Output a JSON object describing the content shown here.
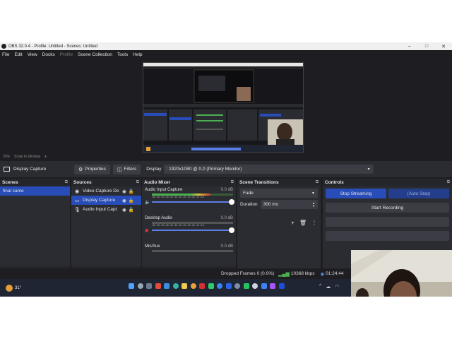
{
  "window": {
    "title": "OBS 32.0.4 - Profile: Untitled - Scenes: Untitled",
    "buttons": [
      "–",
      "□",
      "✕"
    ]
  },
  "menu": {
    "items": [
      "File",
      "Edit",
      "View",
      "Docks",
      "Profile",
      "Scene Collection",
      "Tools",
      "Help"
    ],
    "disabled": [
      "Profile"
    ]
  },
  "preview": {
    "zoom": "35%",
    "scale_mode": "Scale to Window"
  },
  "source_toolbar": {
    "selected_source": "Display Capture",
    "properties_label": "Properties",
    "filters_label": "Filters",
    "display_label": "Display",
    "display_value": ": 1920x1080 @ 0,0 (Primary Monitor)"
  },
  "scenes": {
    "title": "Scenes",
    "items": [
      {
        "label": "final came",
        "selected": true
      }
    ]
  },
  "sources": {
    "title": "Sources",
    "items": [
      {
        "label": "Video Capture De",
        "icon": "camera-icon",
        "selected": false
      },
      {
        "label": "Display Capture",
        "icon": "monitor-icon",
        "selected": true
      },
      {
        "label": "Audio Input Capt",
        "icon": "microphone-icon",
        "selected": false
      }
    ]
  },
  "mixer": {
    "title": "Audio Mixer",
    "ticks": "-60 -55 -50 -45 -40 -35 -30 -25 -20 -15 -10 -5 0",
    "channels": [
      {
        "name": "Audio Input Capture",
        "db": "0.0 dB",
        "level": 0.72,
        "active": true,
        "muted": false
      },
      {
        "name": "Desktop Audio",
        "db": "0.0 dB",
        "level": 0.0,
        "active": false,
        "muted": false
      },
      {
        "name": "Mic/Aux",
        "db": "0.0 dB",
        "level": 0.0,
        "active": false,
        "muted": false
      }
    ]
  },
  "transitions": {
    "title": "Scene Transitions",
    "type": "Fade",
    "duration_label": "Duration",
    "duration_value": "300 ms"
  },
  "controls": {
    "title": "Controls",
    "stop_streaming": "Stop Streaming",
    "auto_stop": "(Auto Stop)",
    "start_recording": "Start Recording"
  },
  "status": {
    "dropped_frames": "Dropped Frames 0 (0.0%)",
    "kbps": "10368 kbps",
    "time": "01:24:44"
  },
  "taskbar": {
    "weather_temp": "31°"
  },
  "colors": {
    "accent": "#284cb8",
    "panel": "#2b2c31",
    "background": "#1e1e22",
    "meter_green": "#4caf50"
  }
}
